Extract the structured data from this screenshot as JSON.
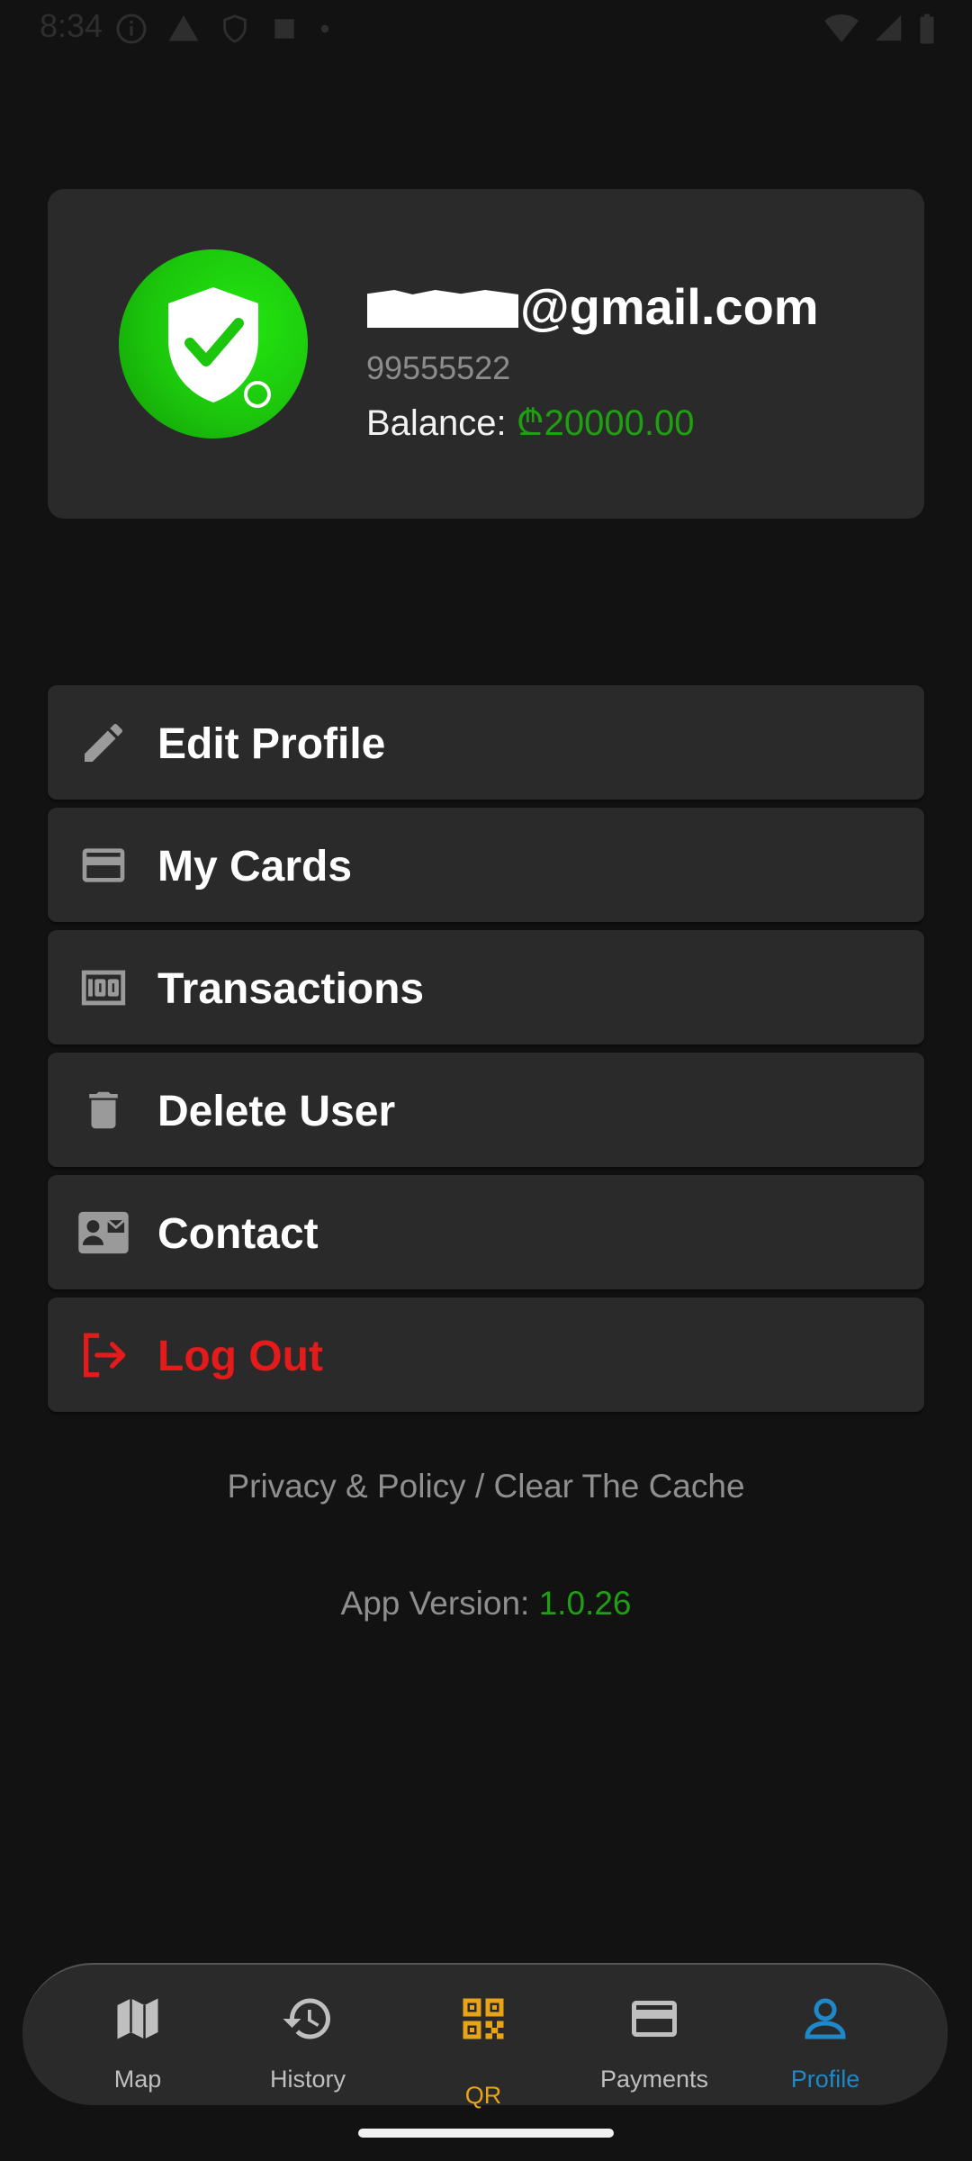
{
  "status_bar": {
    "time": "8:34"
  },
  "profile": {
    "email_suffix": "@gmail.com",
    "phone": "99555522",
    "balance_label": "Balance: ",
    "balance_amount": "₾20000.00"
  },
  "menu": {
    "items": [
      {
        "label": "Edit Profile",
        "icon": "pencil-icon"
      },
      {
        "label": "My Cards",
        "icon": "card-icon"
      },
      {
        "label": "Transactions",
        "icon": "money-icon"
      },
      {
        "label": "Delete User",
        "icon": "trash-icon"
      },
      {
        "label": "Contact",
        "icon": "contact-card-icon"
      },
      {
        "label": "Log Out",
        "icon": "logout-icon"
      }
    ]
  },
  "footer": {
    "links": "Privacy & Policy / Clear The Cache",
    "version_label": "App Version: ",
    "version_number": "1.0.26"
  },
  "nav": {
    "items": [
      {
        "label": "Map",
        "icon": "map-icon"
      },
      {
        "label": "History",
        "icon": "history-icon"
      },
      {
        "label": "QR",
        "icon": "qr-icon"
      },
      {
        "label": "Payments",
        "icon": "card-icon"
      },
      {
        "label": "Profile",
        "icon": "person-icon",
        "active": true
      }
    ]
  },
  "colors": {
    "accent_green": "#1fa012",
    "logout_red": "#e51a1a",
    "active_blue": "#1e88c8",
    "qr_orange": "#e8a317"
  }
}
